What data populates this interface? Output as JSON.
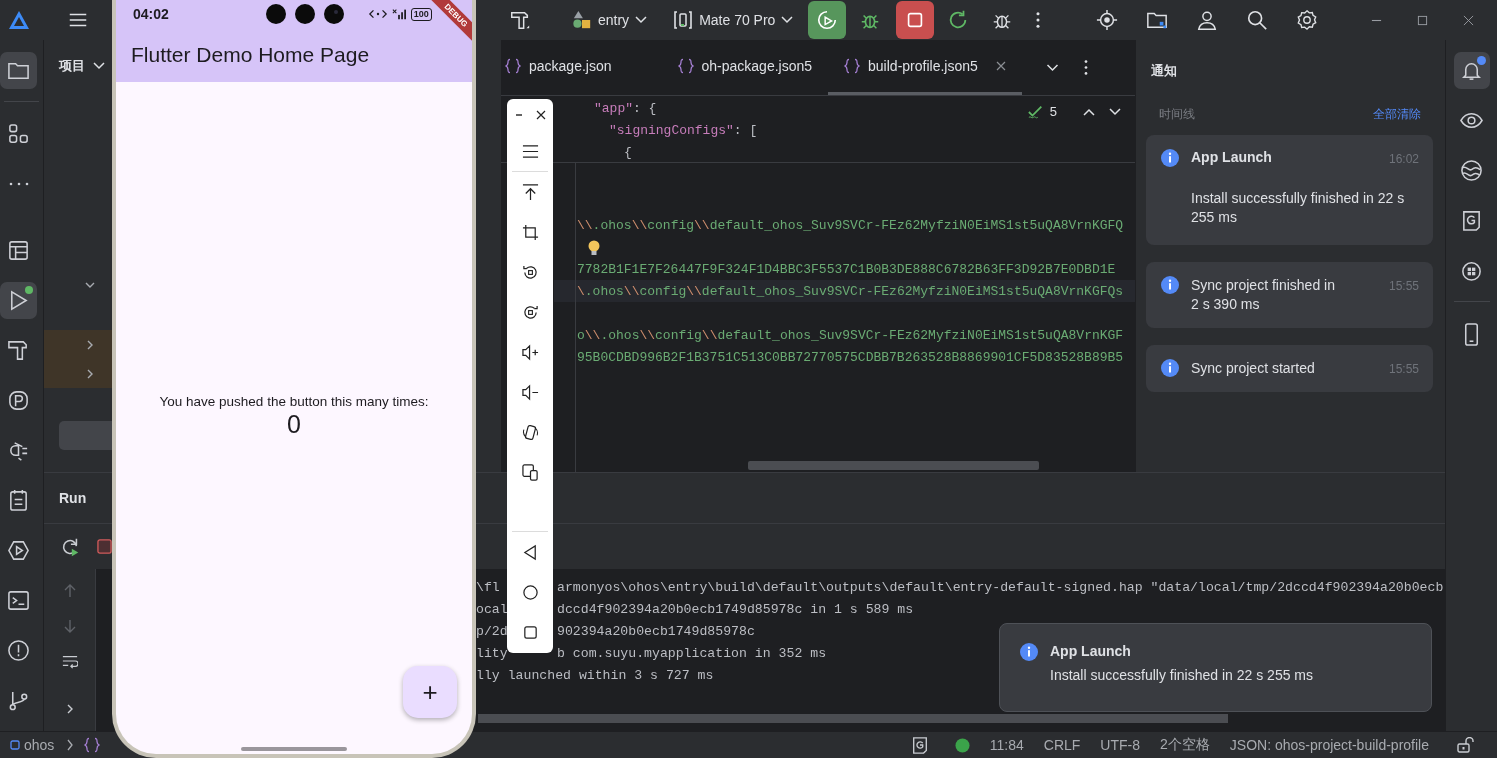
{
  "top_bar": {
    "run_config": "entry",
    "device": "Mate 70 Pro"
  },
  "activity_bar": [
    {
      "kind": "folder",
      "selected": true,
      "badge": false
    },
    {
      "kind": "structure",
      "selected": false,
      "badge": false
    },
    {
      "kind": "more",
      "selected": false,
      "badge": false
    },
    {
      "kind": "layout",
      "selected": false,
      "badge": false
    },
    {
      "kind": "run",
      "selected": true,
      "badge": true
    },
    {
      "kind": "build",
      "selected": false,
      "badge": false
    },
    {
      "kind": "profiler",
      "selected": false,
      "badge": false
    },
    {
      "kind": "plugin",
      "selected": false,
      "badge": false
    },
    {
      "kind": "todo",
      "selected": false,
      "badge": false
    },
    {
      "kind": "services",
      "selected": false,
      "badge": false
    },
    {
      "kind": "terminal",
      "selected": false,
      "badge": false
    },
    {
      "kind": "problems",
      "selected": false,
      "badge": false
    },
    {
      "kind": "git",
      "selected": false,
      "badge": false
    }
  ],
  "project_panel": {
    "title": "项目",
    "tree": [
      {
        "expanded": true,
        "highlighted": false
      },
      {
        "expanded": false,
        "highlighted": true
      },
      {
        "expanded": false,
        "highlighted": true
      }
    ]
  },
  "editor": {
    "tabs": [
      {
        "label": "package.json",
        "selected": false
      },
      {
        "label": "oh-package.json5",
        "selected": false
      },
      {
        "label": "build-profile.json5",
        "selected": true
      }
    ],
    "inspections": "5",
    "sticky_lines": [
      {
        "key": "\"app\"",
        "punct": ": {"
      },
      {
        "key": "\"signingConfigs\"",
        "punct": ": ["
      },
      {
        "punct": "{"
      }
    ],
    "blocks": [
      [
        {
          "text": "\\\\.ohos\\\\config\\\\default_ohos_Suv9SVCr-FEz62MyfziN0EiMS1st5uQA8VrnKGFQ",
          "current": false
        }
      ],
      [
        {
          "text": "7782B1F1E7F26447F9F324F1D4BBC3F5537C1B0B3DE888C6782B63FF3D92B7E0DBD1E",
          "current": false
        },
        {
          "text": "\\.ohos\\\\config\\\\default_ohos_Suv9SVCr-FEz62MyfziN0EiMS1st5uQA8VrnKGFQs",
          "current": true
        }
      ],
      [
        {
          "text": "o\\\\.ohos\\\\config\\\\default_ohos_Suv9SVCr-FEz62MyfziN0EiMS1st5uQA8VrnKGF",
          "current": false
        },
        {
          "text": "95B0CDBD996B2F1B3751C513C0BB72770575CDBB7B263528B8869901CF5D83528B89B5",
          "current": false
        }
      ]
    ]
  },
  "run_panel": {
    "title": "Run",
    "console": [
      {
        "left": "\\fl",
        "right": "armonyos\\ohos\\entry\\build\\default\\outputs\\default\\entry-default-signed.hap \"data/local/tmp/2dccd4f902394a20b0ecb"
      },
      {
        "left": "ocal",
        "right": "dccd4f902394a20b0ecb1749d85978c in 1 s 589 ms"
      },
      {
        "left": "p/2d",
        "right": "902394a20b0ecb1749d85978c"
      },
      {
        "left": "lity",
        "right": "b com.suyu.myapplication in 352 ms"
      },
      {
        "left": "lly launched within 3 s 727 ms"
      }
    ]
  },
  "notifications": {
    "title": "通知",
    "section": "时间线",
    "clear_all": "全部清除",
    "items": [
      {
        "title": "App Launch",
        "time": "16:02",
        "message": "Install successfully finished in 22 s 255 ms"
      },
      {
        "time": "15:55",
        "message": "Sync project finished in 2 s 390 ms"
      },
      {
        "time": "15:55",
        "message": "Sync project started"
      }
    ]
  },
  "right_bar": [
    {
      "kind": "bell",
      "selected": true,
      "badge": true
    },
    {
      "kind": "eye",
      "selected": false,
      "badge": false
    },
    {
      "kind": "globe",
      "selected": false,
      "badge": false
    },
    {
      "kind": "gbox",
      "selected": false,
      "badge": false
    },
    {
      "kind": "robot",
      "selected": false,
      "badge": false
    },
    {
      "kind": "phone",
      "selected": false,
      "badge": false
    }
  ],
  "phone": {
    "time": "04:02",
    "battery": "100",
    "ribbon": "DEBUG",
    "app_title": "Flutter Demo Home Page",
    "message": "You have pushed the button this many times:",
    "counter": "0",
    "fab": "+"
  },
  "toast": {
    "title": "App Launch",
    "message": "Install successfully finished in 22 s 255 ms"
  },
  "status_bar": {
    "breadcrumb": "ohos",
    "line_col": "11:84",
    "line_ending": "CRLF",
    "encoding": "UTF-8",
    "indent": "2个空格",
    "schema": "JSON: ohos-project-build-profile"
  }
}
